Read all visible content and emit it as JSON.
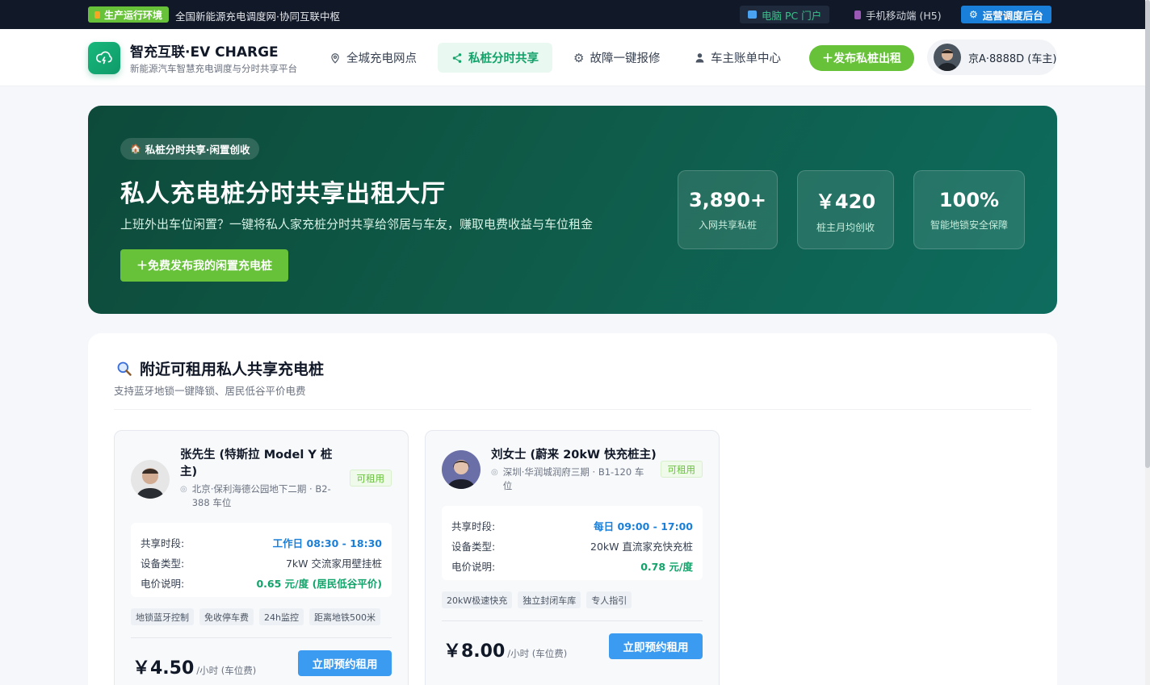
{
  "topbar": {
    "env_badge": "生产运行环境",
    "slogan": "全国新能源充电调度网·协同互联中枢",
    "pc_link": "电脑 PC 门户",
    "h5_link": "手机移动端 (H5)",
    "admin_link": "运营调度后台"
  },
  "header": {
    "brand_title": "智充互联·EV CHARGE",
    "brand_sub": "新能源汽车智慧充电调度与分时共享平台",
    "nav": [
      "全城充电网点",
      "私桩分时共享",
      "故障一键报修",
      "车主账单中心"
    ],
    "publish_label": "发布私桩出租",
    "user_label": "京A·8888D (车主)"
  },
  "hero": {
    "tag": "私桩分时共享·闲置创收",
    "title": "私人充电桩分时共享出租大厅",
    "desc": "上班外出车位闲置？一键将私人家充桩分时共享给邻居与车友，赚取电费收益与车位租金",
    "cta": "免费发布我的闲置充电桩",
    "stats": [
      {
        "num": "3,890+",
        "label": "入网共享私桩"
      },
      {
        "num": "￥420",
        "label": "桩主月均创收"
      },
      {
        "num": "100%",
        "label": "智能地锁安全保障"
      }
    ]
  },
  "list": {
    "title": "附近可租用私人共享充电桩",
    "subtitle": "支持蓝牙地锁一键降锁、居民低谷平价电费",
    "cards": [
      {
        "name": "张先生 (特斯拉 Model Y 桩主)",
        "addr": "北京·保利海德公园地下二期 · B2-388 车位",
        "status": "可租用",
        "rows": [
          {
            "k": "共享时段:",
            "v": "工作日 08:30 - 18:30"
          },
          {
            "k": "设备类型:",
            "v": "7kW 交流家用壁挂桩"
          },
          {
            "k": "电价说明:",
            "v": "0.65 元/度 (居民低谷平价)"
          }
        ],
        "tags": [
          "地锁蓝牙控制",
          "免收停车费",
          "24h监控",
          "距离地铁500米"
        ],
        "price": "￥4.50",
        "unit": "/小时 (车位费)",
        "button": "立即预约租用"
      },
      {
        "name": "刘女士 (蔚来 20kW 快充桩主)",
        "addr": "深圳·华润城润府三期 · B1-120 车位",
        "status": "可租用",
        "rows": [
          {
            "k": "共享时段:",
            "v": "每日 09:00 - 17:00"
          },
          {
            "k": "设备类型:",
            "v": "20kW 直流家充快充桩"
          },
          {
            "k": "电价说明:",
            "v": "0.78 元/度"
          }
        ],
        "tags": [
          "20kW极速快充",
          "独立封闭车库",
          "专人指引"
        ],
        "price": "￥8.00",
        "unit": "/小时 (车位费)",
        "button": "立即预约租用"
      }
    ]
  },
  "colors": {
    "brand_green": "#67c23a",
    "hero_bg": "#0f5a48",
    "accent_blue": "#1a7fd8"
  }
}
